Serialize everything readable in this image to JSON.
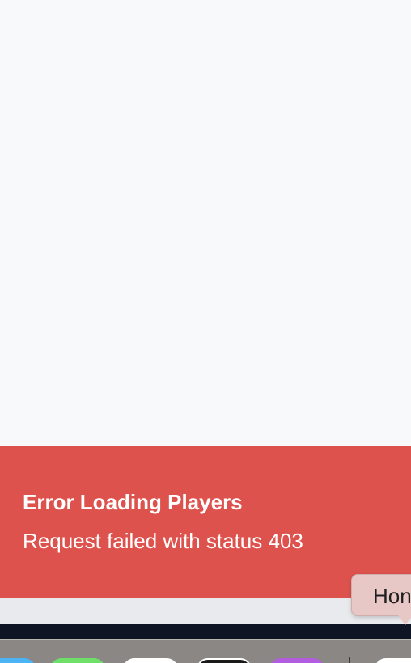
{
  "error": {
    "title": "Error Loading Players",
    "message": "Request failed with status 403"
  },
  "tooltip": {
    "text": "Hon"
  },
  "dock": {
    "apps": [
      {
        "icon": "finder-icon",
        "color": "#4cb3f5"
      },
      {
        "icon": "messages-icon",
        "color": "#6ee06a"
      },
      {
        "icon": "chrome-icon",
        "color": "#ffffff"
      },
      {
        "icon": "terminal-icon",
        "color": "#1a1a1a"
      },
      {
        "icon": "podcasts-icon",
        "color": "#b25ce0"
      },
      {
        "icon": "app-icon",
        "color": "#ffffff"
      }
    ]
  },
  "colors": {
    "error_background": "#de524e",
    "page_background": "#f8f9fb",
    "tooltip_background": "#e8c8c6"
  }
}
